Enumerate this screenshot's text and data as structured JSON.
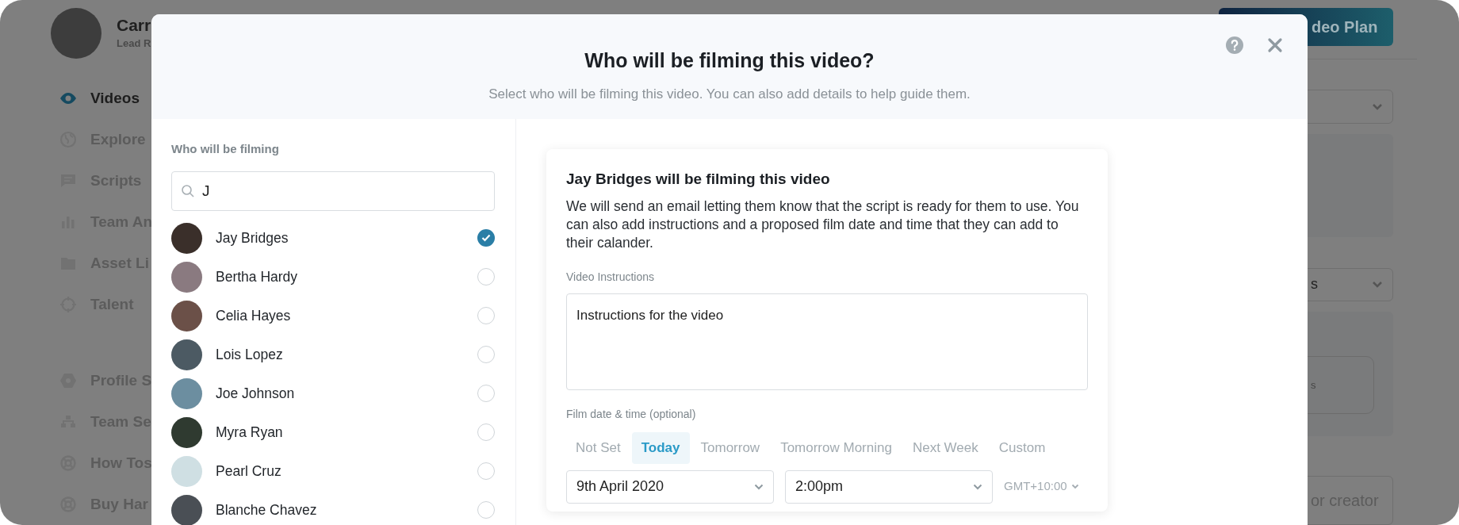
{
  "background": {
    "user": {
      "name": "Carr",
      "role": "Lead R"
    },
    "nav_main": [
      {
        "label": "Videos",
        "selected": true
      },
      {
        "label": "Explore",
        "selected": false
      },
      {
        "label": "Scripts",
        "selected": false
      },
      {
        "label": "Team An",
        "selected": false
      },
      {
        "label": "Asset Li",
        "selected": false
      },
      {
        "label": "Talent",
        "selected": false
      }
    ],
    "nav_secondary": [
      {
        "label": "Profile S"
      },
      {
        "label": "Team Se"
      },
      {
        "label": "How Tos"
      },
      {
        "label": "Buy Har"
      }
    ],
    "top_button": "deo Plan",
    "dropdown_2": {
      "value": "s"
    },
    "card": {
      "text": "s"
    },
    "search": {
      "placeholder": "or creator"
    }
  },
  "modal": {
    "title": "Who will be filming this video?",
    "subtitle": "Select who will be filming this video. You can also add details to help guide them.",
    "filmers": {
      "label": "Who will be filming",
      "search": {
        "value": "J"
      },
      "people": [
        {
          "name": "Jay Bridges",
          "selected": true
        },
        {
          "name": "Bertha Hardy",
          "selected": false
        },
        {
          "name": "Celia Hayes",
          "selected": false
        },
        {
          "name": "Lois Lopez",
          "selected": false
        },
        {
          "name": "Joe Johnson",
          "selected": false
        },
        {
          "name": "Myra Ryan",
          "selected": false
        },
        {
          "name": "Pearl Cruz",
          "selected": false
        },
        {
          "name": "Blanche Chavez",
          "selected": false
        }
      ]
    },
    "details": {
      "title": "Jay Bridges will be filming this video",
      "body": "We will send an email letting them know that the script is ready for them to use. You can also add instructions and a proposed film date and time that they can add to their calander.",
      "instructions_label": "Video Instructions",
      "instructions": {
        "value": "Instructions for the video"
      },
      "date_label": "Film date & time (optional)",
      "date_options": [
        {
          "label": "Not Set",
          "selected": false
        },
        {
          "label": "Today",
          "selected": true
        },
        {
          "label": "Tomorrow",
          "selected": false
        },
        {
          "label": "Tomorrow Morning",
          "selected": false
        },
        {
          "label": "Next Week",
          "selected": false
        },
        {
          "label": "Custom",
          "selected": false
        }
      ],
      "date": {
        "value": "9th April 2020"
      },
      "time": {
        "value": "2:00pm"
      },
      "timezone": {
        "value": "GMT+10:00"
      }
    }
  }
}
